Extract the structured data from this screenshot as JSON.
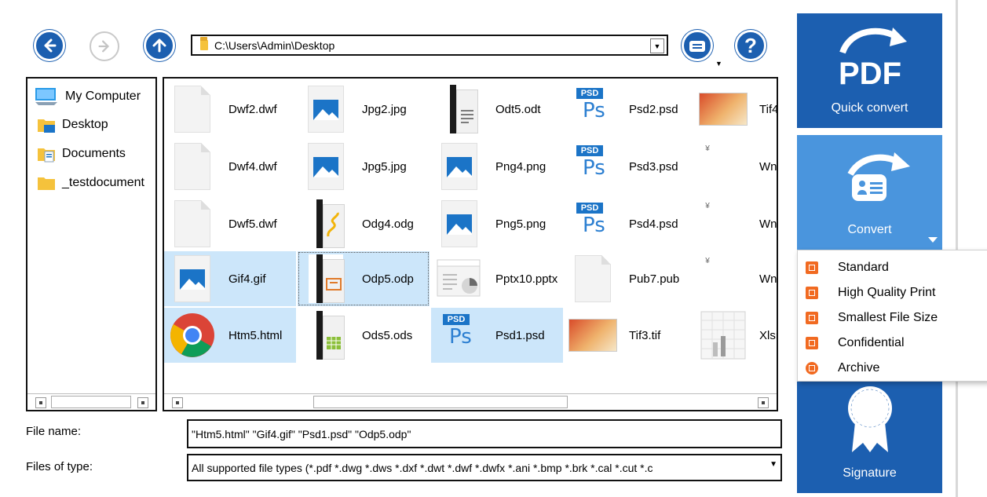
{
  "toolbar": {
    "back_icon": "back-arrow-icon",
    "forward_icon": "forward-arrow-icon",
    "up_icon": "up-arrow-icon",
    "path_value": "C:\\Users\\Admin\\Desktop",
    "view_icon": "view-options-icon",
    "help_label": "?"
  },
  "tree": {
    "items": [
      {
        "label": "My Computer",
        "icon": "computer-icon"
      },
      {
        "label": "Desktop",
        "icon": "desktop-folder-icon"
      },
      {
        "label": "Documents",
        "icon": "documents-folder-icon"
      },
      {
        "label": "_testdocument",
        "icon": "folder-icon"
      }
    ]
  },
  "files": {
    "col1": [
      "Dwf2.dwf",
      "Dwf4.dwf",
      "Dwf5.dwf",
      "Gif4.gif",
      "Htm5.html"
    ],
    "col2": [
      "Jpg2.jpg",
      "Jpg5.jpg",
      "Odg4.odg",
      "Odp5.odp",
      "Ods5.ods"
    ],
    "col3": [
      "Odt5.odt",
      "Png4.png",
      "Png5.png",
      "Pptx10.pptx",
      "Psd1.psd"
    ],
    "col4": [
      "Psd2.psd",
      "Psd3.psd",
      "Psd4.psd",
      "Pub7.pub",
      "Tif3.tif"
    ],
    "col5": [
      "Tif4",
      "Wn",
      "Wn",
      "Wn",
      "Xlsn"
    ],
    "psd_tag": "PSD",
    "ps_text": "Ps"
  },
  "bottom": {
    "filename_label": "File name:",
    "filename_value": "\"Htm5.html\" \"Gif4.gif\" \"Psd1.psd\" \"Odp5.odp\"",
    "filetype_label": "Files of type:",
    "filetype_value": "All supported file types (*.pdf *.dwg *.dws *.dxf *.dwt *.dwf *.dwfx *.ani *.bmp *.brk *.cal *.cut *.c"
  },
  "sidebar": {
    "pdf_text": "PDF",
    "quick_convert": "Quick convert",
    "convert": "Convert",
    "signature": "Signature",
    "colors": {
      "dark_tile": "#1c5fb0",
      "light_tile": "#4a95dd",
      "menu_icon": "#f16a21"
    }
  },
  "convert_menu": {
    "items": [
      {
        "label": "Standard",
        "icon": "standard-pdf-icon"
      },
      {
        "label": "High Quality Print",
        "icon": "print-icon"
      },
      {
        "label": "Smallest File Size",
        "icon": "compress-icon"
      },
      {
        "label": "Confidential",
        "icon": "confidential-icon"
      },
      {
        "label": "Archive",
        "icon": "archive-icon"
      }
    ]
  }
}
